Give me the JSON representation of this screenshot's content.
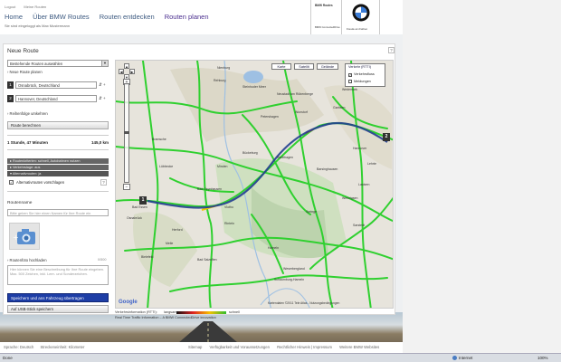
{
  "header": {
    "top_links": [
      "Logout",
      "Meine Routen"
    ],
    "nav": [
      {
        "label": "Home",
        "active": false
      },
      {
        "label": "Über BMW Routes",
        "active": false
      },
      {
        "label": "Routen entdecken",
        "active": false
      },
      {
        "label": "Routen planen",
        "active": true
      }
    ],
    "logged_in": "Sie sind eingeloggt als Max Mustermann",
    "brand_title": "BMW Routes",
    "brand_sub": "BMW ConnectedDrive",
    "logo_caption": "Freude am Fahren"
  },
  "panel": {
    "title": "Neue Route",
    "help": "?",
    "saved_routes_select": "Bestehende Routen auswählen",
    "plan_new": "› Neue Route planen",
    "stops": [
      {
        "num": "1",
        "value": "Osnabrück, Deutschland"
      },
      {
        "num": "2",
        "value": "Hannover, Deutschland"
      }
    ],
    "reverse": "› Reihenfolge umkehren",
    "calc_button": "Route berechnen",
    "duration": "1 Stunde, 47 Minuten",
    "distance": "145,0 km",
    "prefs": [
      "▸ Routenkriterien: schnell, Autobahnen nutzen",
      "▸ Verkehrslage: aus",
      "▾ Alternativrouten: ja"
    ],
    "alt_routes_label": "Alternativrouten vorschlagen",
    "alt_routes_checked": true,
    "route_name_label": "Routenname",
    "route_name_placeholder": "Bitte geben Sie hier einen Namen für Ihre Route ein",
    "photo_upload": "› Routenfoto hochladen",
    "counter": "0/500",
    "description_placeholder": "Hier können Sie eine Beschreibung für Ihre Route eingeben. Max. 500 Zeichen, inkl. Leer- und Sonderzeichen.",
    "save_button": "Speichern und ans Fahrzeug übertragen",
    "usb_button": "Auf USB-Stick speichern"
  },
  "map": {
    "map_types": [
      "Karte",
      "Satellit",
      "Gelände"
    ],
    "traffic_title": "Verkehr (RTTI)",
    "traffic_options": [
      {
        "label": "Verkehrsfluss",
        "checked": true
      },
      {
        "label": "Meldungen",
        "checked": false
      }
    ],
    "markers": [
      "1",
      "2"
    ],
    "places": [
      "Steinhuder Meer",
      "Rehburg",
      "Nienburg",
      "Wunstorf",
      "Garbsen",
      "Rinteln",
      "Minden",
      "Bückeburg",
      "Stadthagen",
      "Barsinghausen",
      "Lübbecke",
      "Bad Essen",
      "Bad Oeynhausen",
      "Herford",
      "Bielefeld",
      "Bad Salzuflen",
      "Hameln",
      "Springe",
      "Hannover",
      "Wennigsen",
      "Osnabrück",
      "Bramsche",
      "Melle",
      "Vlotho",
      "Petershagen",
      "Neustadt am Rübenberge",
      "Wedemark",
      "Lehrte",
      "Laatzen",
      "Sarstedt",
      "Weserbergland",
      "Schaumburg-Hameln"
    ],
    "google_logo": "Google",
    "copyright": "Kartendaten ©2011 Tele Atlas - Nutzungsbedingungen"
  },
  "legend": {
    "title": "Verkehrsinformation (RTTI):",
    "slow": "langsam",
    "fast": "schnell",
    "source": "Real Time Traffic Information – A BMW ConnectedDrive innovation"
  },
  "footer": {
    "left": [
      "Sprache: Deutsch",
      "Streckeneinheit: Kilometer"
    ],
    "right": [
      "Sitemap",
      "Verfügbarkeit und Voraussetzungen",
      "Rechtlicher Hinweis | Impressum",
      "Weitere BMW Websites"
    ]
  },
  "statusbar": {
    "left": "Done",
    "zone": "Internet",
    "zoom": "100%"
  },
  "colors": {
    "nav_active": "#4b2f8f",
    "nav_link": "#3d5a80",
    "primary_button": "#1e3ea6",
    "traffic_green": "#2fd02f",
    "route_line": "#223e8f"
  }
}
